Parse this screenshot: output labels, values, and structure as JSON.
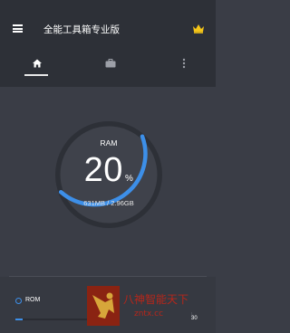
{
  "appbar": {
    "title": "全能工具箱专业版",
    "menu_icon": "menu-icon",
    "premium_icon": "crown-icon",
    "premium_color": "#f5c518"
  },
  "tabs": [
    {
      "name": "home",
      "icon": "home-icon",
      "selected": true
    },
    {
      "name": "tools",
      "icon": "briefcase-icon",
      "selected": false
    },
    {
      "name": "more",
      "icon": "more-vertical-icon",
      "selected": false
    }
  ],
  "ram": {
    "label": "RAM",
    "percent_text": "20",
    "unit": "%",
    "detail": "631MB / 2.96GB",
    "usage_fraction": 0.2,
    "arc_color": "#3d8fe8"
  },
  "rom": {
    "label": "ROM",
    "dot_color": "#3d8fe8",
    "usage_fraction": 0.08,
    "bar_left_text": "1%",
    "bar_right_text": "30"
  },
  "watermark": {
    "text_cn": "八神智能天下",
    "text_en": "zntx.cc"
  },
  "colors": {
    "background": "#3a3d46",
    "appbar": "#2d3037",
    "accent": "#3d8fe8"
  }
}
